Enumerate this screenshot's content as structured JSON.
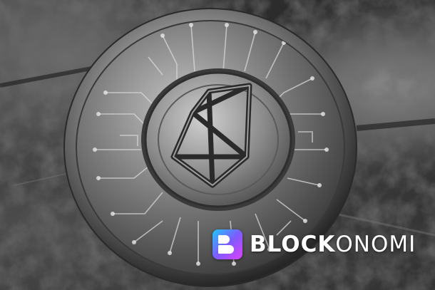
{
  "image": {
    "subject": "silver-eos-coin",
    "colors": {
      "background": "#2b2b2b",
      "coin_metal": "#9a9a9a",
      "brand_text": "#ffffff",
      "logo_gradient_start": "#1ec8ff",
      "logo_gradient_end": "#e040fb"
    }
  },
  "watermark": {
    "brand_bold": "BLOCK",
    "brand_light": "ONOMI",
    "icon": "blockonomi-logo-icon"
  }
}
